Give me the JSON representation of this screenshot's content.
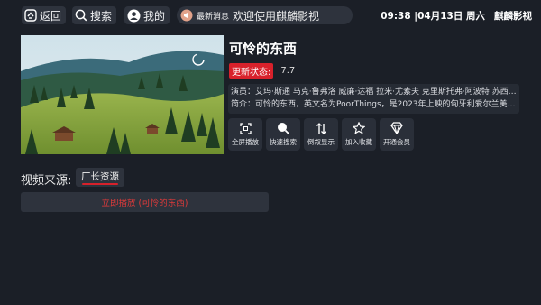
{
  "nav": {
    "back_label": "返回",
    "search_label": "搜索",
    "mine_label": "我的"
  },
  "notice": {
    "tag": "最新消息",
    "message": "欢迎使用麒麟影视"
  },
  "clock": {
    "datetime": "09:38 |04月13日 周六",
    "app_name": "麒麟影视"
  },
  "movie": {
    "title": "可怜的东西",
    "status_label": "更新状态:",
    "status_value": "7.7",
    "actors": "演员：艾玛·斯通 马克·鲁弗洛 威廉·达福 拉米·尤素夫 克里斯托弗·阿波特 苏西·本...",
    "synopsis": "简介：可怜的东西，英文名为PoorThings，是2023年上映的匈牙利爱尔兰美国英..."
  },
  "actions": [
    {
      "label": "全屏播放",
      "icon": "fullscreen-icon"
    },
    {
      "label": "快速搜索",
      "icon": "search-icon"
    },
    {
      "label": "倒叙显示",
      "icon": "sort-icon"
    },
    {
      "label": "加入收藏",
      "icon": "star-icon"
    },
    {
      "label": "开通会员",
      "icon": "vip-icon"
    }
  ],
  "source": {
    "label": "视频来源:",
    "selected": "厂长资源"
  },
  "play_button_label": "立即播放 (可怜的东西)",
  "colors": {
    "background": "#1b1f27",
    "accent_red": "#d8212b",
    "panel": "#2e333d"
  }
}
